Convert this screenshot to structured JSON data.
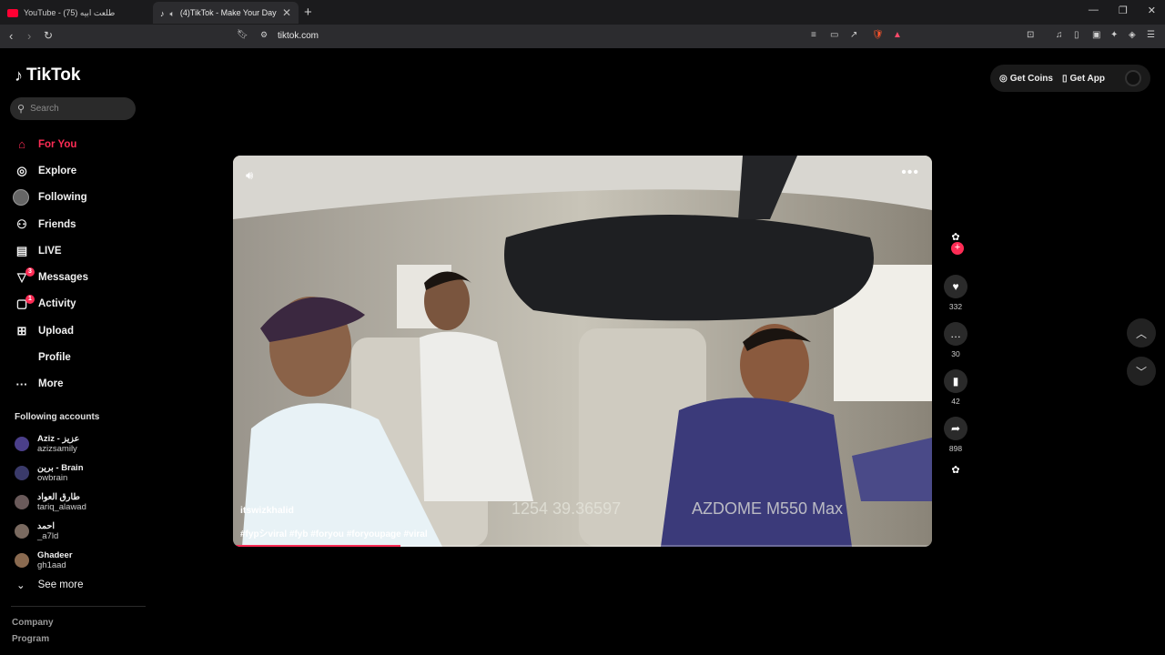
{
  "browser": {
    "tabs": [
      {
        "title": "YouTube - طلعت ابيه (75)",
        "active": false,
        "favicon_color": "#ff0033"
      },
      {
        "title": "(4)TikTok - Make Your Day",
        "active": true,
        "favicon_color": "#ffffff"
      }
    ],
    "url": "tiktok.com"
  },
  "app": {
    "logo_text": "TikTok",
    "search_placeholder": "Search"
  },
  "nav": [
    {
      "label": "For You",
      "icon": "home-icon",
      "active": true
    },
    {
      "label": "Explore",
      "icon": "compass-icon"
    },
    {
      "label": "Following",
      "icon": "following-avatar"
    },
    {
      "label": "Friends",
      "icon": "friends-icon"
    },
    {
      "label": "LIVE",
      "icon": "live-icon"
    },
    {
      "label": "Messages",
      "icon": "paper-plane-icon",
      "badge": "3"
    },
    {
      "label": "Activity",
      "icon": "activity-icon",
      "badge": "1"
    },
    {
      "label": "Upload",
      "icon": "upload-icon"
    },
    {
      "label": "Profile",
      "icon": "profile-icon"
    },
    {
      "label": "More",
      "icon": "more-icon"
    }
  ],
  "following_accounts": {
    "title": "Following accounts",
    "accounts": [
      {
        "name": "Aziz - عزيز",
        "handle": "azizsamily",
        "color": "#4b3f8a"
      },
      {
        "name": "برين - Brain",
        "handle": "owbrain",
        "color": "#3a3a6a"
      },
      {
        "name": "طارق العواد",
        "handle": "tariq_alawad",
        "color": "#6a5a5a"
      },
      {
        "name": "احمد",
        "handle": "_a7ld",
        "color": "#7a6a60"
      },
      {
        "name": "Ghadeer",
        "handle": "gh1aad",
        "color": "#8a6a50"
      }
    ],
    "see_more": "See more"
  },
  "footer": [
    "Company",
    "Program"
  ],
  "top_right": {
    "coins": "Get Coins",
    "app": "Get App"
  },
  "video": {
    "author": "itswizkhalid",
    "caption": "#fypシviral #fyb #foryou #foryoupage #viral",
    "overlay_coords": "1254 39.36597",
    "overlay_model": "AZDOME M550 Max",
    "progress": 0.24
  },
  "actions": {
    "likes": "332",
    "comments": "30",
    "saves": "42",
    "shares": "898"
  },
  "colors": {
    "accent": "#fe2c55"
  }
}
